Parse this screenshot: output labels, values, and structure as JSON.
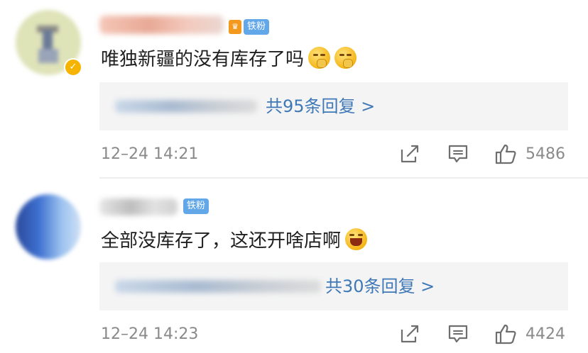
{
  "comments": [
    {
      "badge": "铁粉",
      "text": "唯独新疆的没有库存了吗",
      "emojis": [
        "shush-emoji",
        "shush-emoji"
      ],
      "reply_count_label": "共95条回复 >",
      "timestamp": "12–24 14:21",
      "likes": "5486"
    },
    {
      "badge": "铁粉",
      "text": "全部没库存了，这还开啥店啊",
      "emojis": [
        "laughing-emoji"
      ],
      "reply_count_label": "共30条回复 >",
      "timestamp": "12–24 14:23",
      "likes": "4424"
    }
  ],
  "colors": {
    "link_blue": "#3f78b7",
    "badge_blue": "#62a7e8",
    "meta_gray": "#8a8a8a",
    "reply_bg": "#f4f4f4"
  },
  "icons": {
    "share": "share-icon",
    "comment": "comment-icon",
    "like": "thumbs-up-icon",
    "verified": "verified-check-icon"
  }
}
